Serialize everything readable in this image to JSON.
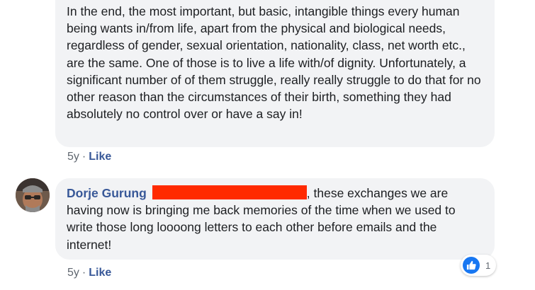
{
  "comments": [
    {
      "text": "In the end, the most important, but basic, intangible things every human being wants in/from life, apart from the physical and biological needs, regardless of gender, sexual orientation, nationality, class, net worth etc., are the same. One of those is to live a life with/of dignity. Unfortunately, a significant number of of them struggle, really really struggle to do that for no other reason than the circumstances of their birth, something they had absolutely no control over or have a say in!",
      "time": "5y",
      "like_label": "Like"
    },
    {
      "author": "Dorje Gurung",
      "text": ", these exchanges we are having now is bringing me back memories of the time when we used to write those long loooong letters to each other before emails and the internet!",
      "time": "5y",
      "like_label": "Like",
      "reaction_count": "1"
    }
  ],
  "separator": "·",
  "colors": {
    "bubble": "#f2f3f5",
    "link": "#385898",
    "meta": "#606770",
    "redaction": "#ff2a00",
    "like_badge": "#1877f2"
  }
}
